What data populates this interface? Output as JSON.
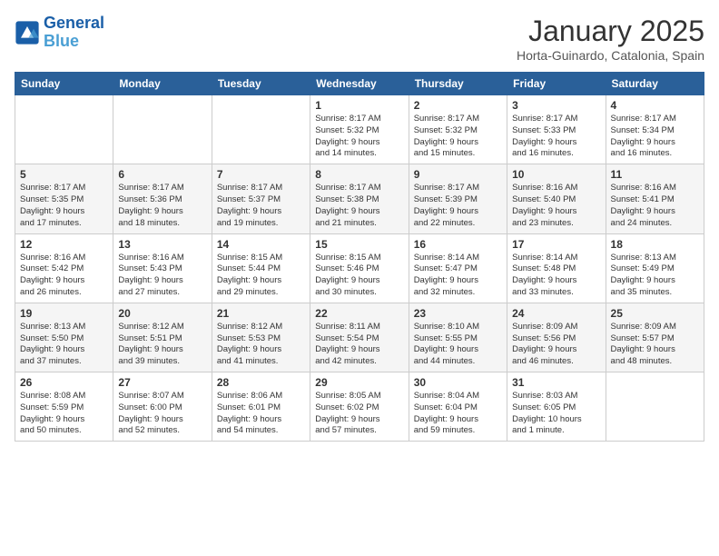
{
  "header": {
    "logo_line1": "General",
    "logo_line2": "Blue",
    "month": "January 2025",
    "location": "Horta-Guinardo, Catalonia, Spain"
  },
  "weekdays": [
    "Sunday",
    "Monday",
    "Tuesday",
    "Wednesday",
    "Thursday",
    "Friday",
    "Saturday"
  ],
  "weeks": [
    [
      {
        "day": "",
        "info": ""
      },
      {
        "day": "",
        "info": ""
      },
      {
        "day": "",
        "info": ""
      },
      {
        "day": "1",
        "info": "Sunrise: 8:17 AM\nSunset: 5:32 PM\nDaylight: 9 hours\nand 14 minutes."
      },
      {
        "day": "2",
        "info": "Sunrise: 8:17 AM\nSunset: 5:32 PM\nDaylight: 9 hours\nand 15 minutes."
      },
      {
        "day": "3",
        "info": "Sunrise: 8:17 AM\nSunset: 5:33 PM\nDaylight: 9 hours\nand 16 minutes."
      },
      {
        "day": "4",
        "info": "Sunrise: 8:17 AM\nSunset: 5:34 PM\nDaylight: 9 hours\nand 16 minutes."
      }
    ],
    [
      {
        "day": "5",
        "info": "Sunrise: 8:17 AM\nSunset: 5:35 PM\nDaylight: 9 hours\nand 17 minutes."
      },
      {
        "day": "6",
        "info": "Sunrise: 8:17 AM\nSunset: 5:36 PM\nDaylight: 9 hours\nand 18 minutes."
      },
      {
        "day": "7",
        "info": "Sunrise: 8:17 AM\nSunset: 5:37 PM\nDaylight: 9 hours\nand 19 minutes."
      },
      {
        "day": "8",
        "info": "Sunrise: 8:17 AM\nSunset: 5:38 PM\nDaylight: 9 hours\nand 21 minutes."
      },
      {
        "day": "9",
        "info": "Sunrise: 8:17 AM\nSunset: 5:39 PM\nDaylight: 9 hours\nand 22 minutes."
      },
      {
        "day": "10",
        "info": "Sunrise: 8:16 AM\nSunset: 5:40 PM\nDaylight: 9 hours\nand 23 minutes."
      },
      {
        "day": "11",
        "info": "Sunrise: 8:16 AM\nSunset: 5:41 PM\nDaylight: 9 hours\nand 24 minutes."
      }
    ],
    [
      {
        "day": "12",
        "info": "Sunrise: 8:16 AM\nSunset: 5:42 PM\nDaylight: 9 hours\nand 26 minutes."
      },
      {
        "day": "13",
        "info": "Sunrise: 8:16 AM\nSunset: 5:43 PM\nDaylight: 9 hours\nand 27 minutes."
      },
      {
        "day": "14",
        "info": "Sunrise: 8:15 AM\nSunset: 5:44 PM\nDaylight: 9 hours\nand 29 minutes."
      },
      {
        "day": "15",
        "info": "Sunrise: 8:15 AM\nSunset: 5:46 PM\nDaylight: 9 hours\nand 30 minutes."
      },
      {
        "day": "16",
        "info": "Sunrise: 8:14 AM\nSunset: 5:47 PM\nDaylight: 9 hours\nand 32 minutes."
      },
      {
        "day": "17",
        "info": "Sunrise: 8:14 AM\nSunset: 5:48 PM\nDaylight: 9 hours\nand 33 minutes."
      },
      {
        "day": "18",
        "info": "Sunrise: 8:13 AM\nSunset: 5:49 PM\nDaylight: 9 hours\nand 35 minutes."
      }
    ],
    [
      {
        "day": "19",
        "info": "Sunrise: 8:13 AM\nSunset: 5:50 PM\nDaylight: 9 hours\nand 37 minutes."
      },
      {
        "day": "20",
        "info": "Sunrise: 8:12 AM\nSunset: 5:51 PM\nDaylight: 9 hours\nand 39 minutes."
      },
      {
        "day": "21",
        "info": "Sunrise: 8:12 AM\nSunset: 5:53 PM\nDaylight: 9 hours\nand 41 minutes."
      },
      {
        "day": "22",
        "info": "Sunrise: 8:11 AM\nSunset: 5:54 PM\nDaylight: 9 hours\nand 42 minutes."
      },
      {
        "day": "23",
        "info": "Sunrise: 8:10 AM\nSunset: 5:55 PM\nDaylight: 9 hours\nand 44 minutes."
      },
      {
        "day": "24",
        "info": "Sunrise: 8:09 AM\nSunset: 5:56 PM\nDaylight: 9 hours\nand 46 minutes."
      },
      {
        "day": "25",
        "info": "Sunrise: 8:09 AM\nSunset: 5:57 PM\nDaylight: 9 hours\nand 48 minutes."
      }
    ],
    [
      {
        "day": "26",
        "info": "Sunrise: 8:08 AM\nSunset: 5:59 PM\nDaylight: 9 hours\nand 50 minutes."
      },
      {
        "day": "27",
        "info": "Sunrise: 8:07 AM\nSunset: 6:00 PM\nDaylight: 9 hours\nand 52 minutes."
      },
      {
        "day": "28",
        "info": "Sunrise: 8:06 AM\nSunset: 6:01 PM\nDaylight: 9 hours\nand 54 minutes."
      },
      {
        "day": "29",
        "info": "Sunrise: 8:05 AM\nSunset: 6:02 PM\nDaylight: 9 hours\nand 57 minutes."
      },
      {
        "day": "30",
        "info": "Sunrise: 8:04 AM\nSunset: 6:04 PM\nDaylight: 9 hours\nand 59 minutes."
      },
      {
        "day": "31",
        "info": "Sunrise: 8:03 AM\nSunset: 6:05 PM\nDaylight: 10 hours\nand 1 minute."
      },
      {
        "day": "",
        "info": ""
      }
    ]
  ]
}
